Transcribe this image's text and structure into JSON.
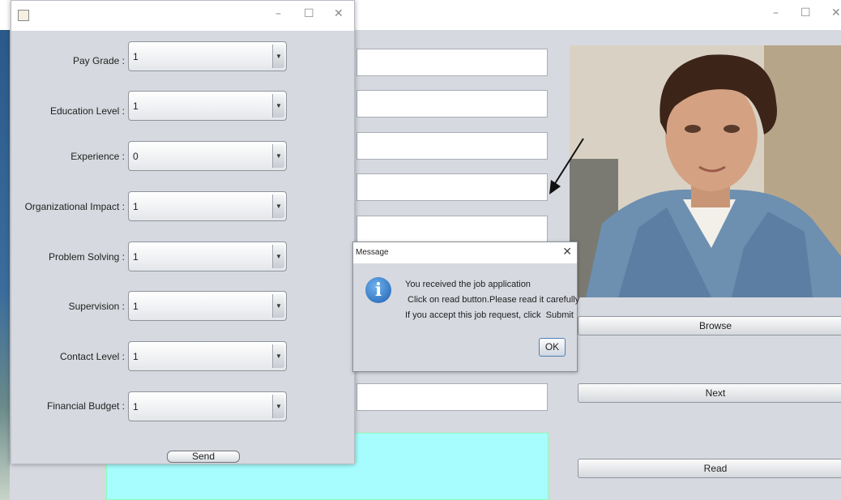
{
  "background_window": {
    "controls": {
      "minimize": "–",
      "maximize": "☐",
      "close": "✕"
    },
    "buttons": {
      "browse": "Browse",
      "next": "Next",
      "read": "Read"
    },
    "icons": {
      "photo": "person-photo",
      "arrow": "pointer-arrow-icon"
    }
  },
  "form_window": {
    "controls": {
      "minimize": "–",
      "maximize": "☐",
      "close": "✕"
    },
    "icons": {
      "app": "java-app-icon",
      "dropdown": "chevron-down-icon"
    },
    "rows": [
      {
        "label": "Pay Grade :",
        "value": "1"
      },
      {
        "label": "Education Level :",
        "value": "1"
      },
      {
        "label": "Experience :",
        "value": "0"
      },
      {
        "label": "Organizational Impact :",
        "value": "1"
      },
      {
        "label": "Problem Solving :",
        "value": "1"
      },
      {
        "label": "Supervision :",
        "value": "1"
      },
      {
        "label": "Contact Level :",
        "value": "1"
      },
      {
        "label": "Financial Budget :",
        "value": "1"
      }
    ],
    "send_label": "Send"
  },
  "message_dialog": {
    "title": "Message",
    "close": "✕",
    "icon": "info-icon",
    "icon_glyph": "i",
    "lines": [
      "You received the job application",
      " Click on read button.Please read it carefully",
      "If you accept this job request, click  Submit"
    ],
    "ok_label": "OK"
  },
  "colors": {
    "panel": "#d6d9df",
    "cyan_area": "#a7fdfd",
    "info_blue": "#1d5fb0"
  }
}
